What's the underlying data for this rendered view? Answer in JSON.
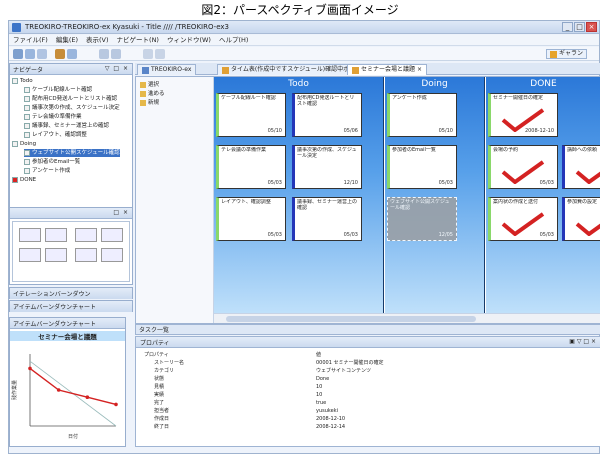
{
  "caption": "図2：パースペクティブ画面イメージ",
  "window": {
    "title": "TREOKIRO-TREOKIRO-ex Kyasuki - Title //// /TREOKIRO-ex3",
    "menu": [
      "ファイル(F)",
      "編集(E)",
      "表示(V)",
      "ナビゲート(N)",
      "ウィンドウ(W)",
      "ヘルプ(H)"
    ],
    "perspective_label": "ギャラン"
  },
  "left_top_panel": {
    "tab_label": "ナビゲータ",
    "tree": [
      {
        "label": "Todo",
        "level": 0
      },
      {
        "label": "ケーブル配線ルート確認",
        "level": 1
      },
      {
        "label": "配布用CD発送ルートとリスト確認",
        "level": 1
      },
      {
        "label": "議事次第の作成、スケジュール決定",
        "level": 1
      },
      {
        "label": "テレ会議の準備作業",
        "level": 1
      },
      {
        "label": "議事録、セミナー運営上の確認",
        "level": 1
      },
      {
        "label": "レイアウト、確認調整",
        "level": 1
      },
      {
        "label": "Doing",
        "level": 0
      },
      {
        "label": "ウェブサイト公開スケジュール確認",
        "level": 1
      },
      {
        "label": "参加者のEmail一覧",
        "level": 1
      },
      {
        "label": "アンケート作成",
        "level": 1
      },
      {
        "label": "DONE",
        "level": 0
      }
    ]
  },
  "left_mid_panel": {
    "tab_label": ""
  },
  "left_bottom_tabs": [
    "イテレーションバーンダウン",
    "アイテムバーンダウンチャート"
  ],
  "chart_data": {
    "type": "line",
    "title": "セミナー会場と議題",
    "xlabel": "日付",
    "ylabel": "残作業量",
    "series": [
      {
        "name": "",
        "values": [
          8,
          5,
          4,
          3
        ]
      }
    ],
    "ideal": [
      9,
      0
    ],
    "ylim": [
      0,
      10
    ]
  },
  "editor": {
    "tabs": [
      "TREOKIRO-ex",
      "タイム表(作成中ですスケジュール)確認中ボード",
      "セミナー会場と議題"
    ],
    "outline": [
      "選択",
      "進める",
      "新規"
    ],
    "lanes": [
      {
        "title": "Todo",
        "cards": [
          {
            "text": "ケーブル配線ルート確認",
            "date": "05/10",
            "accent": "green"
          },
          {
            "text": "配布用CD発送ルートとリスト確認",
            "date": "05/06",
            "accent": "blue"
          },
          {
            "text": "テレ会議の準備作業",
            "date": "05/03",
            "accent": "green"
          },
          {
            "text": "議事次第の作成、スケジュール決定",
            "date": "12/10",
            "accent": "blue"
          },
          {
            "text": "レイアウト、確認調整",
            "date": "05/03",
            "accent": "green"
          },
          {
            "text": "議事録、セミナー運営上の確認",
            "date": "05/03",
            "accent": "blue"
          }
        ]
      },
      {
        "title": "Doing",
        "cards": [
          {
            "text": "アンケート作成",
            "date": "05/10",
            "accent": "green"
          },
          {
            "text": "参加者のEmail一覧",
            "date": "05/03",
            "accent": "green"
          },
          {
            "text": "ウェブサイト公開スケジュール確認",
            "date": "12/05",
            "accent": "ghost"
          }
        ]
      },
      {
        "title": "DONE",
        "cards": [
          {
            "text": "セミナー開催日の確定",
            "date": "2008-12-10",
            "accent": "green"
          },
          {
            "text": "会場の予約",
            "date": "05/03",
            "accent": "green"
          },
          {
            "text": "講師への依頼",
            "date": "",
            "accent": "blue"
          },
          {
            "text": "案内状の作成と送付",
            "date": "05/03",
            "accent": "green"
          },
          {
            "text": "参加費の設定",
            "date": "",
            "accent": "blue"
          }
        ]
      }
    ]
  },
  "bottom": {
    "tab_label": "タスク一覧",
    "properties_label": "プロパティ",
    "properties": [
      {
        "key": "プロパティ",
        "value": "値"
      },
      {
        "key": "ストーリー名",
        "value": "00001 セミナー開催日の確定"
      },
      {
        "key": "カテゴリ",
        "value": "ウェブサイトコンテンツ"
      },
      {
        "key": "状態",
        "value": "Done"
      },
      {
        "key": "見積",
        "value": "10"
      },
      {
        "key": "実績",
        "value": "10"
      },
      {
        "key": "完了",
        "value": "true"
      },
      {
        "key": "担当者",
        "value": "yusukeki"
      },
      {
        "key": "作成日",
        "value": "2008-12-10"
      },
      {
        "key": "終了日",
        "value": "2008-12-14"
      }
    ]
  },
  "colors": {
    "lane_top": "#2b78d8",
    "lane_bottom": "#bfe0fa",
    "check_red": "#d42222",
    "chart_line": "#d42222"
  }
}
